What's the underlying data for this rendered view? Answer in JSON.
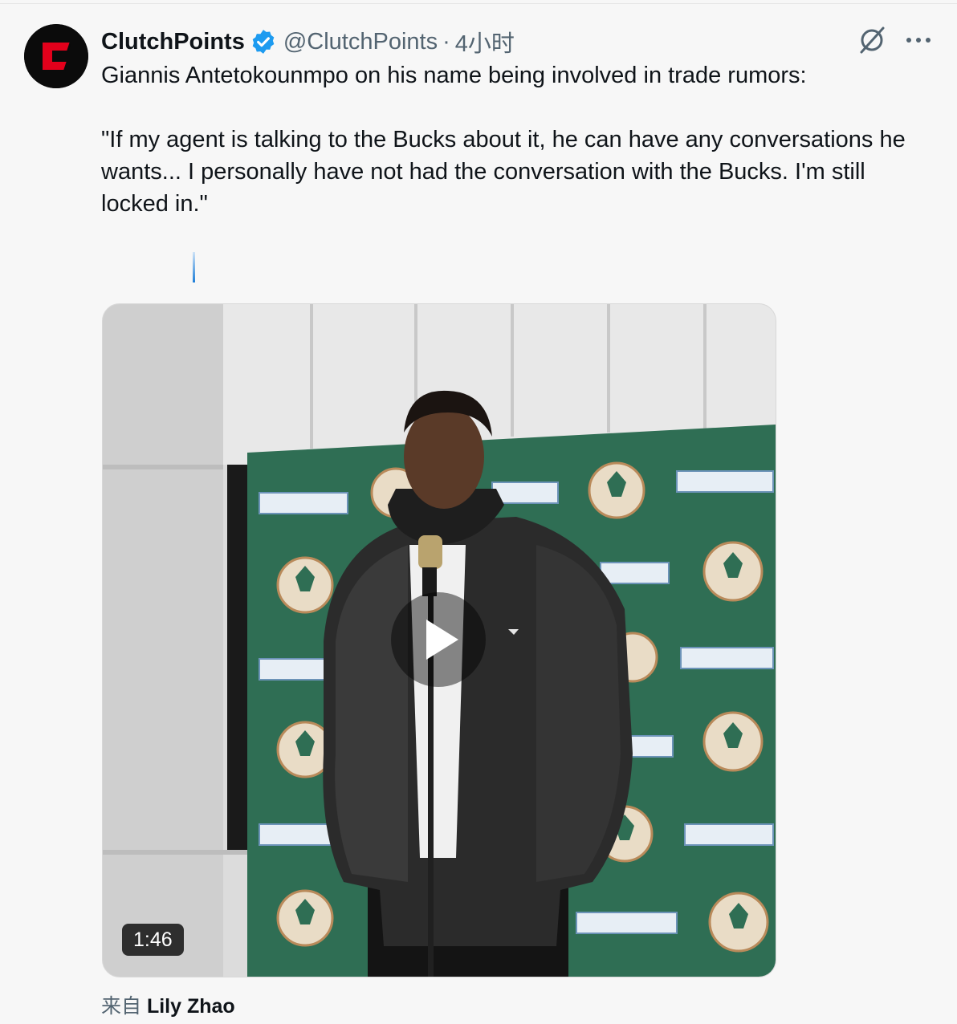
{
  "tweet": {
    "author": {
      "name": "ClutchPoints",
      "handle": "@ClutchPoints",
      "separator": "·",
      "timestamp": "4小时",
      "verified": true,
      "brand_color": "#e3001b"
    },
    "text": "Giannis Antetokounmpo on his name being involved in trade rumors:\n\n\"If my agent is talking to the Bucks about it, he can have any conversations he wants... I personally have not had the conversation with the Bucks. I'm still locked in.\"",
    "media": {
      "type": "video",
      "duration": "1:46"
    },
    "source": {
      "prefix": "来自",
      "name": "Lily Zhao"
    }
  },
  "icons": {
    "verified": "verified-badge-icon",
    "grok": "grok-icon",
    "more": "more-icon",
    "play": "play-icon"
  },
  "colors": {
    "verified_blue": "#1d9bf0",
    "backdrop_green": "#2f6e54"
  }
}
